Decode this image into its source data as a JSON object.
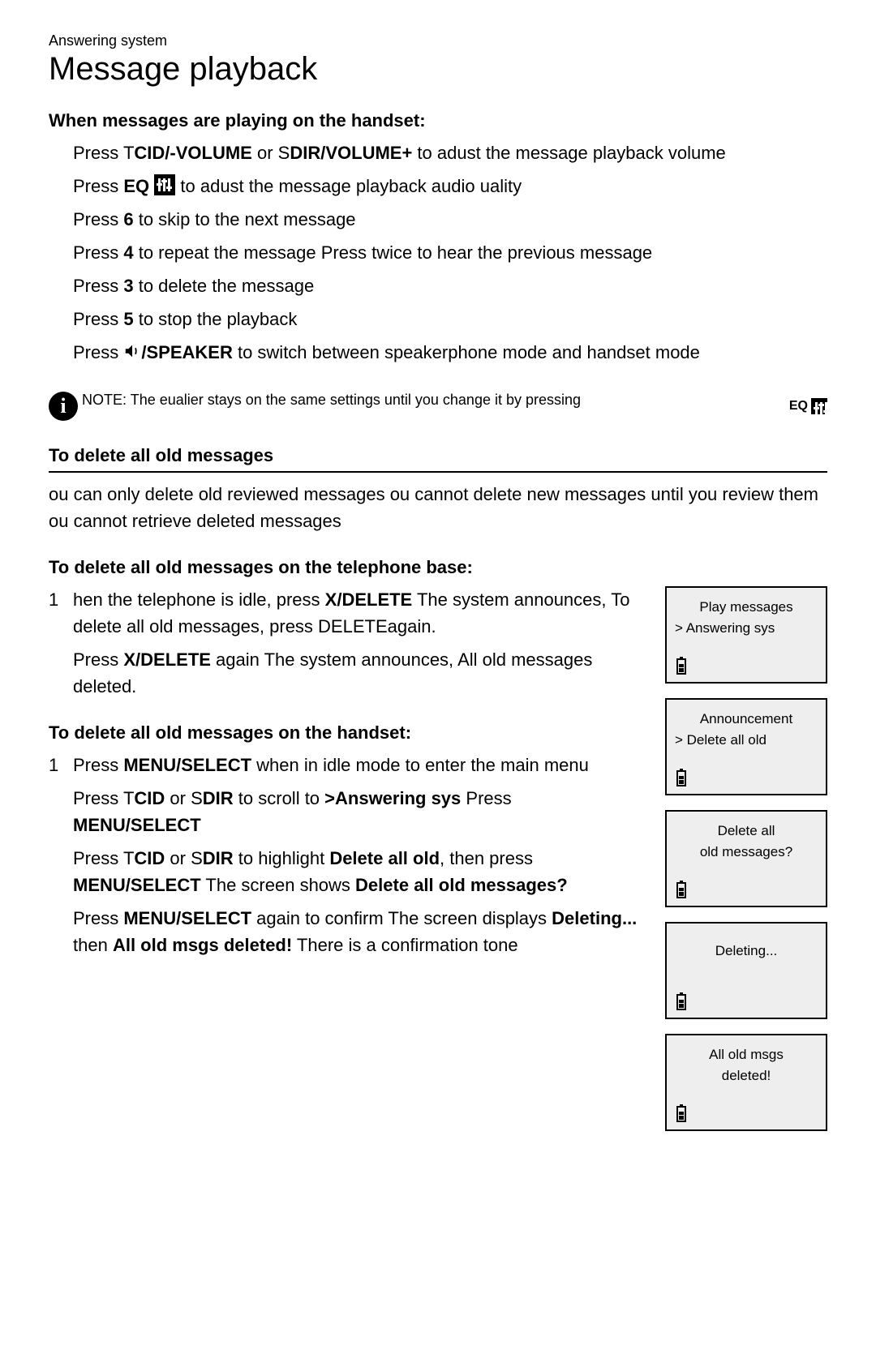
{
  "breadcrumb": "Answering system",
  "title": "Message playback",
  "section1": {
    "heading": "When messages are playing on the handset:",
    "line1_a": "Press ",
    "line1_b": "T",
    "line1_c": "CID",
    "line1_d": "/-VOLUME",
    "line1_e": " or ",
    "line1_f": "S",
    "line1_g": "DIR",
    "line1_h": "/VOLUME+",
    "line1_i": " to adust the message playback volume",
    "line2_a": "Press ",
    "line2_b": "EQ",
    "line2_c": " to adust the message playback    audio uality",
    "line3_a": "Press ",
    "line3_b": "6",
    "line3_c": " to skip to the next message",
    "line4_a": "Press ",
    "line4_b": "4",
    "line4_c": " to repeat the message Press twice to hear the previous message",
    "line5_a": "Press ",
    "line5_b": "3",
    "line5_c": " to delete the message",
    "line6_a": "Press ",
    "line6_b": "5",
    "line6_c": " to stop the playback",
    "line7_a": "Press ",
    "line7_b": "/SPEAKER",
    "line7_c": " to switch between speakerphone mode and handset mode"
  },
  "note": {
    "label": "NOTE:",
    "text": " The eualier stays on the same settings until you change it by pressing",
    "eq": "EQ"
  },
  "section2": {
    "heading": "To delete all old messages",
    "intro": "ou can only delete old reviewed messages ou cannot delete new messages until you review them ou cannot retrieve deleted messages",
    "sub1": "To delete all old messages on the telephone base:",
    "s1_num": "1",
    "s1_a": "hen the    telephone is idle, press ",
    "s1_b": "X/DELETE",
    "s1_c": " The system announces,  ",
    "s1_d": "To delete all old messages, press DELETEagain.",
    "s1_e": "Press ",
    "s1_f": "X/DELETE",
    "s1_g": " again The system announces,   ",
    "s1_h": "All old messages deleted.",
    "sub2": "To delete all old messages on the handset:",
    "s2_num": "1",
    "s2_a": "Press ",
    "s2_b": "MENU/",
    "s2_b2": "SELECT",
    "s2_c": " when in idle mode to enter the main menu",
    "s2_d": "Press ",
    "s2_e": "T",
    "s2_f": "CID",
    "s2_g": " or ",
    "s2_h": "S",
    "s2_i": "DIR",
    "s2_j": " to scroll to ",
    "s2_k": ">Answering sys",
    "s2_l": " Press ",
    "s2_m": "MENU",
    "s2_m2": "/SELECT",
    "s2_n": "Press ",
    "s2_o": "T",
    "s2_p": "CID",
    "s2_q": " or ",
    "s2_r": "S",
    "s2_s": "DIR",
    "s2_t": " to  highlight ",
    "s2_u": "Delete all old",
    "s2_v": ", then press ",
    "s2_w": "MENU",
    "s2_w2": "/SELECT",
    "s2_x": " The screen  shows ",
    "s2_y": "Delete all old messages?",
    "s2_z1": "Press ",
    "s2_z2": "MENU",
    "s2_z2b": "/SELECT",
    "s2_z3": " again to confirm The screen    displays ",
    "s2_z4": "Deleting...",
    "s2_z5": " then ",
    "s2_z6": "All old msgs deleted!",
    "s2_z7": " There is  a confirmation tone"
  },
  "screens": [
    {
      "line1": "Play messages",
      "line2": "> Answering sys",
      "center": false
    },
    {
      "line1": "Announcement",
      "line2": "> Delete all old",
      "center": false
    },
    {
      "line1": "Delete all",
      "line2": "old messages?",
      "center": true
    },
    {
      "line1": "Deleting...",
      "line2": "",
      "center": false
    },
    {
      "line1": "All old msgs",
      "line2": "deleted!",
      "center": true
    }
  ]
}
